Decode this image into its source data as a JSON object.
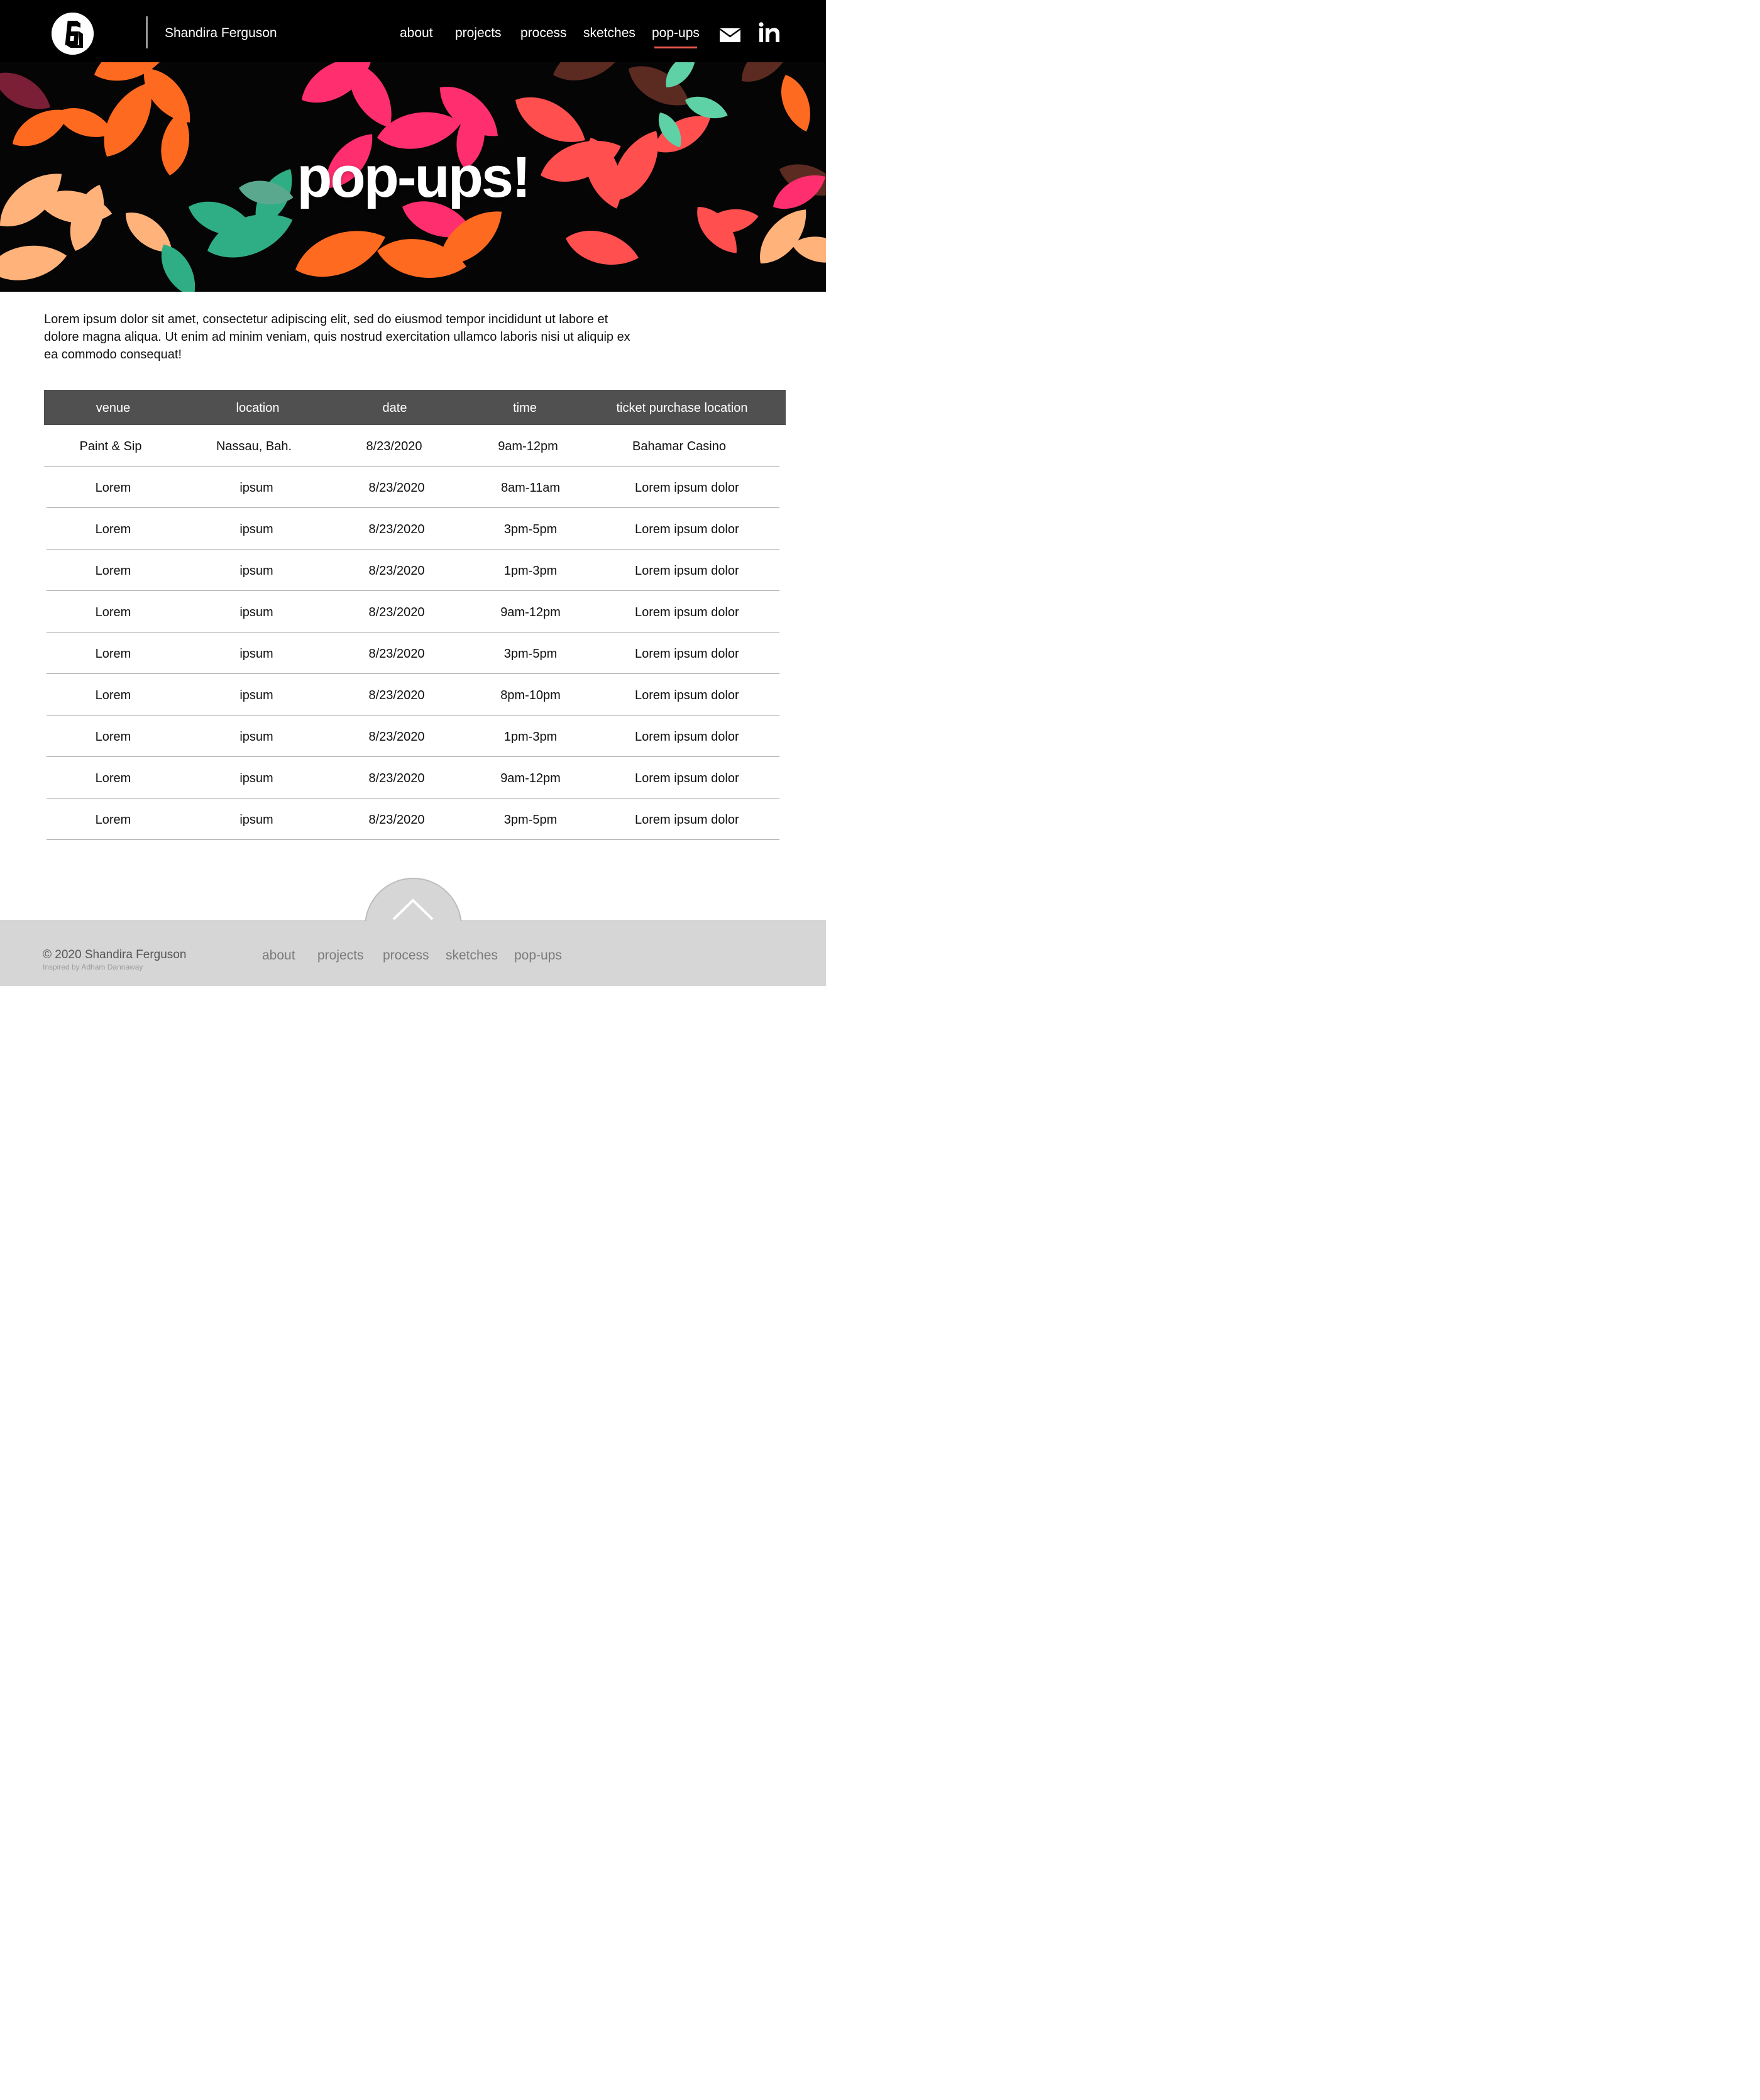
{
  "header": {
    "brand_name": "Shandira Ferguson",
    "nav": [
      {
        "label": "about"
      },
      {
        "label": "projects"
      },
      {
        "label": "process"
      },
      {
        "label": "sketches"
      },
      {
        "label": "pop-ups",
        "active": true
      }
    ],
    "icons": [
      "mail-icon",
      "linkedin-icon"
    ],
    "active_indicator_color": "#ee5a4e"
  },
  "hero": {
    "title": "pop-ups!",
    "palette": [
      "#ff6a21",
      "#ff2e6e",
      "#2fae86",
      "#ffb27a",
      "#ff4f4f",
      "#7a1f36",
      "#5aa88e"
    ]
  },
  "intro": {
    "text": "Lorem ipsum dolor sit amet, consectetur adipiscing elit, sed do eiusmod tempor incididunt ut labore et dolore magna aliqua. Ut enim ad minim veniam, quis nostrud exercitation ullamco laboris nisi ut aliquip ex ea commodo consequat!"
  },
  "table": {
    "headers": [
      "venue",
      "location",
      "date",
      "time",
      "ticket purchase location"
    ],
    "rows": [
      [
        "Paint & Sip",
        "Nassau, Bah.",
        "8/23/2020",
        "9am-12pm",
        "Bahamar Casino"
      ],
      [
        "Lorem",
        "ipsum",
        "8/23/2020",
        "8am-11am",
        "Lorem ipsum dolor"
      ],
      [
        "Lorem",
        "ipsum",
        "8/23/2020",
        "3pm-5pm",
        "Lorem ipsum dolor"
      ],
      [
        "Lorem",
        "ipsum",
        "8/23/2020",
        "1pm-3pm",
        "Lorem ipsum dolor"
      ],
      [
        "Lorem",
        "ipsum",
        "8/23/2020",
        "9am-12pm",
        "Lorem ipsum dolor"
      ],
      [
        "Lorem",
        "ipsum",
        "8/23/2020",
        "3pm-5pm",
        "Lorem ipsum dolor"
      ],
      [
        "Lorem",
        "ipsum",
        "8/23/2020",
        "8pm-10pm",
        "Lorem ipsum dolor"
      ],
      [
        "Lorem",
        "ipsum",
        "8/23/2020",
        "1pm-3pm",
        "Lorem ipsum dolor"
      ],
      [
        "Lorem",
        "ipsum",
        "8/23/2020",
        "9am-12pm",
        "Lorem ipsum dolor"
      ],
      [
        "Lorem",
        "ipsum",
        "8/23/2020",
        "3pm-5pm",
        "Lorem ipsum dolor"
      ]
    ]
  },
  "footer": {
    "copyright": "© 2020 Shandira Ferguson",
    "credit": "Inspired by Adham Dannaway",
    "nav": [
      {
        "label": "about"
      },
      {
        "label": "projects"
      },
      {
        "label": "process"
      },
      {
        "label": "sketches"
      },
      {
        "label": "pop-ups"
      }
    ],
    "scroll_top_icon": "chevron-up-icon"
  }
}
